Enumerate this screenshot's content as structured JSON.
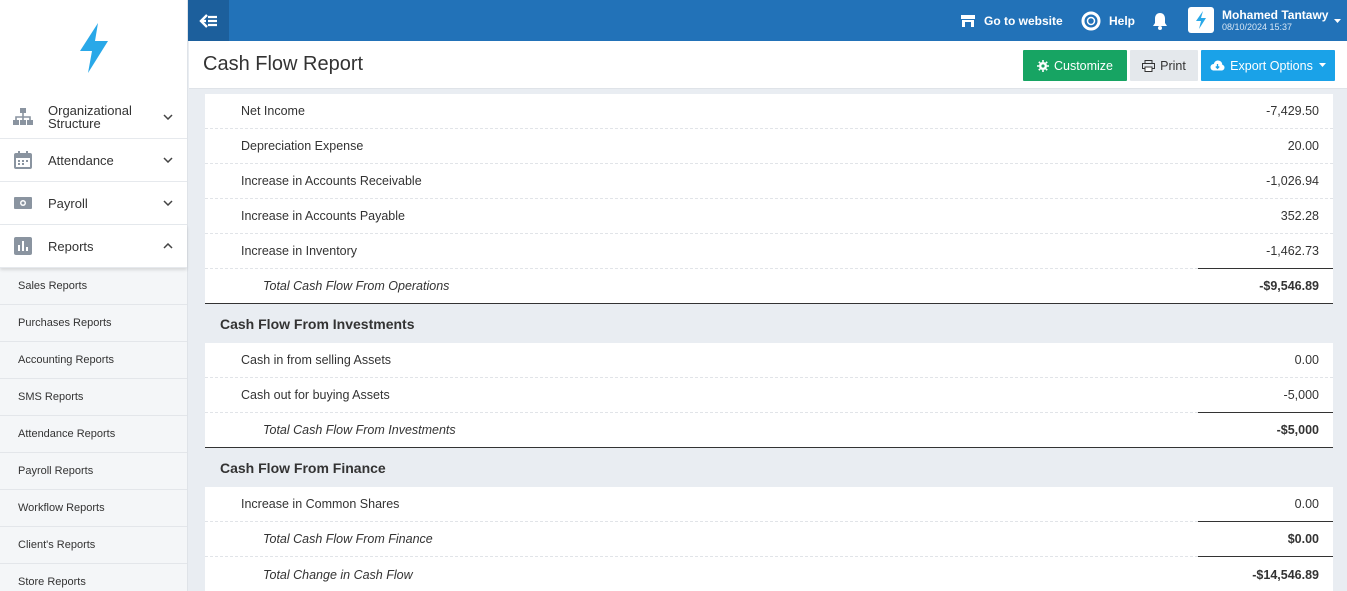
{
  "topbar": {
    "go_to_website": "Go to website",
    "help": "Help",
    "user_name": "Mohamed Tantawy",
    "user_date": "08/10/2024 15:37"
  },
  "sidebar": {
    "items": [
      {
        "label": "Organizational Structure",
        "icon": "org-chart-icon"
      },
      {
        "label": "Attendance",
        "icon": "calendar-icon"
      },
      {
        "label": "Payroll",
        "icon": "money-icon"
      },
      {
        "label": "Reports",
        "icon": "bar-chart-icon"
      }
    ],
    "submenu": [
      "Sales Reports",
      "Purchases Reports",
      "Accounting Reports",
      "SMS Reports",
      "Attendance Reports",
      "Payroll Reports",
      "Workflow Reports",
      "Client's Reports",
      "Store Reports"
    ]
  },
  "header": {
    "title": "Cash Flow Report",
    "customize": "Customize",
    "print": "Print",
    "export": "Export Options"
  },
  "report": {
    "operations": [
      {
        "label": "Net Income",
        "value": "-7,429.50"
      },
      {
        "label": "Depreciation Expense",
        "value": "20.00"
      },
      {
        "label": "Increase in Accounts Receivable",
        "value": "-1,026.94"
      },
      {
        "label": "Increase in Accounts Payable",
        "value": "352.28"
      },
      {
        "label": "Increase in Inventory",
        "value": "-1,462.73"
      }
    ],
    "operations_total": {
      "label": "Total Cash Flow From Operations",
      "value": "-$9,546.89"
    },
    "investments_title": "Cash Flow From Investments",
    "investments": [
      {
        "label": "Cash in from selling Assets",
        "value": "0.00"
      },
      {
        "label": "Cash out for buying Assets",
        "value": "-5,000"
      }
    ],
    "investments_total": {
      "label": "Total Cash Flow From Investments",
      "value": "-$5,000"
    },
    "finance_title": "Cash Flow From Finance",
    "finance": [
      {
        "label": "Increase in Common Shares",
        "value": "0.00"
      }
    ],
    "finance_total": {
      "label": "Total Cash Flow From Finance",
      "value": "$0.00"
    },
    "change_total": {
      "label": "Total Change in Cash Flow",
      "value": "-$14,546.89"
    }
  },
  "colors": {
    "topbar": "#2272b8",
    "customize": "#17a463",
    "export": "#1aa2e8",
    "logo": "#29a8e8"
  }
}
